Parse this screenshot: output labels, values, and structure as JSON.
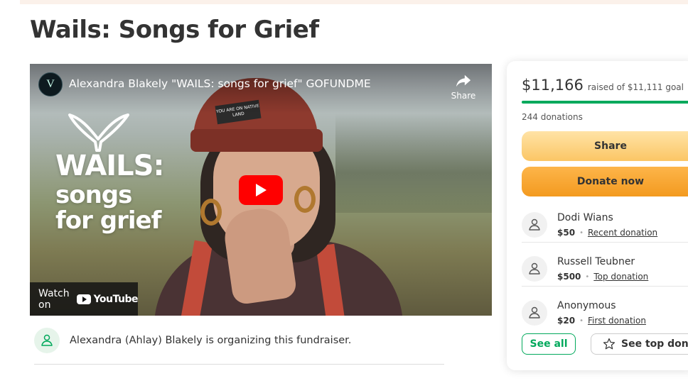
{
  "page": {
    "title": "Wails: Songs for Grief"
  },
  "video": {
    "channel_initials": "V",
    "title": "Alexandra Blakely \"WAILS: songs for grief\" GOFUNDME",
    "share_label": "Share",
    "overlay_line1": "WAILS:",
    "overlay_line2": "songs",
    "overlay_line3": "for grief",
    "beanie_text": "YOU ARE ON NATIVE LAND",
    "watch_on_label": "Watch on",
    "youtube_label": "YouTube"
  },
  "organizer": {
    "text": "Alexandra (Ahlay) Blakely is organizing this fundraiser."
  },
  "donation_card": {
    "raised_amount": "$11,166",
    "raised_of": "raised of $11,111 goal",
    "progress_fraction": 1.0,
    "donation_count": "244 donations",
    "share_label": "Share",
    "donate_label": "Donate now",
    "donors": [
      {
        "name": "Dodi Wians",
        "amount": "$50",
        "tag": "Recent donation"
      },
      {
        "name": "Russell Teubner",
        "amount": "$500",
        "tag": "Top donation"
      },
      {
        "name": "Anonymous",
        "amount": "$20",
        "tag": "First donation"
      }
    ],
    "see_all_label": "See all",
    "see_top_label": "See top donat"
  },
  "colors": {
    "progress_green": "#02a95c",
    "donate_orange": "#f39a20",
    "share_yellow": "#fbc665",
    "youtube_red": "#ff0000"
  },
  "icons": {
    "share": "share-arrow-icon",
    "play": "play-icon",
    "donor": "heart-hand-icon",
    "star": "star-icon"
  }
}
